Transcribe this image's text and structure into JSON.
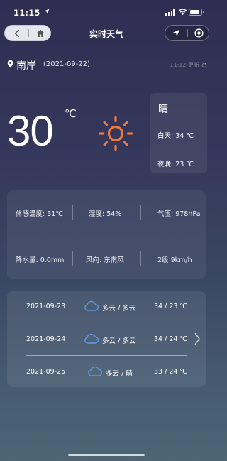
{
  "status_bar": {
    "time": "11:15",
    "icons": [
      "location-arrow-icon",
      "signal-icon",
      "wifi-icon",
      "battery-icon"
    ],
    "battery_level": 0.85
  },
  "nav": {
    "title": "实时天气",
    "icons": [
      "back-icon",
      "home-icon",
      "location-icon",
      "close-target-icon"
    ]
  },
  "location": {
    "name": "南岸",
    "date": "(2021-09-22)",
    "update_text": "11:12 更新",
    "icon": "map-pin-icon"
  },
  "current": {
    "temperature": "30",
    "unit": "℃",
    "icon": "sun-icon",
    "sun_color": "#f07a3c"
  },
  "today": {
    "condition": "晴",
    "day": "白天: 34 ℃",
    "night": "夜晚: 23 ℃"
  },
  "details": {
    "feels_like": "体感温度: 31℃",
    "humidity": "湿度: 54%",
    "pressure": "气压: 978hPa",
    "precipitation": "降水量: 0.0mm",
    "wind_direction": "风向: 东南风",
    "wind_level": "2级 9km/h"
  },
  "forecast": [
    {
      "date": "2021-09-23",
      "condition": "多云 / 多云",
      "temp": "34 / 23 ℃",
      "icon": "cloud-icon"
    },
    {
      "date": "2021-09-24",
      "condition": "多云 / 多云",
      "temp": "34 / 24 ℃",
      "icon": "cloud-icon"
    },
    {
      "date": "2021-09-25",
      "condition": "多云 / 晴",
      "temp": "33 / 24 ℃",
      "icon": "cloud-icon"
    }
  ],
  "colors": {
    "cloud_icon": "#5b9be8",
    "accent": "#f07a3c"
  }
}
